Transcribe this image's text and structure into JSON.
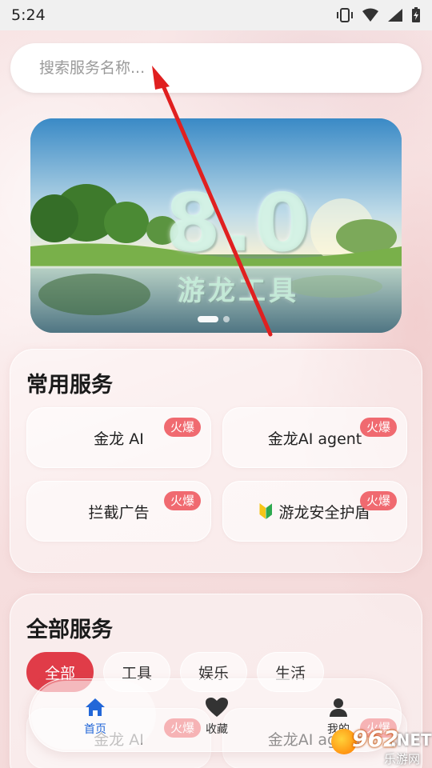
{
  "status_bar": {
    "time": "5:24"
  },
  "search": {
    "placeholder": "搜索服务名称..."
  },
  "banner": {
    "version": "8.0",
    "title": "游龙工具"
  },
  "common_services": {
    "title": "常用服务",
    "hot_label": "火爆",
    "items": [
      {
        "label": "金龙 AI"
      },
      {
        "label": "金龙AI agent"
      },
      {
        "label": "拦截广告"
      },
      {
        "label": "游龙安全护盾"
      }
    ]
  },
  "all_services": {
    "title": "全部服务",
    "tabs": [
      "全部",
      "工具",
      "娱乐",
      "生活"
    ],
    "active_tab": "全部",
    "items": [
      {
        "label": "金龙 AI"
      },
      {
        "label": "金龙AI agent"
      }
    ]
  },
  "bottom_nav": {
    "items": [
      {
        "label": "首页",
        "icon": "home-icon",
        "active": true
      },
      {
        "label": "收藏",
        "icon": "heart-icon",
        "active": false
      },
      {
        "label": "我的",
        "icon": "user-icon",
        "active": false
      }
    ]
  },
  "watermark": {
    "number": "962",
    "suffix": ".NET",
    "subtitle": "乐游网"
  },
  "colors": {
    "accent_red": "#e03c48",
    "hot_badge": "#f06a70",
    "nav_active": "#2367d8"
  }
}
